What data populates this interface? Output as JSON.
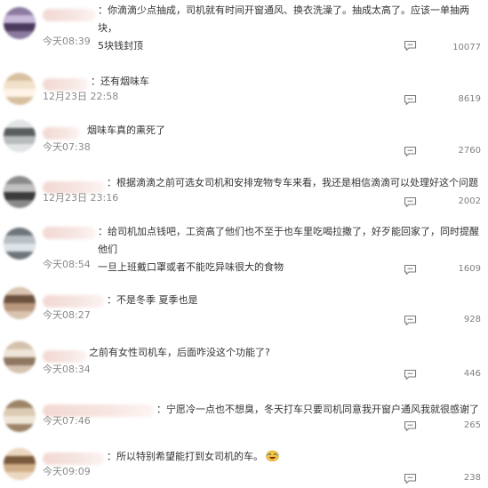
{
  "comments": [
    {
      "text": "：你滴滴少点抽成，司机就有时间开窗通风、换衣洗澡了。抽成太高了。应该一单抽两块，\n5块钱封顶",
      "time": "今天08:39",
      "count": "10077",
      "avatar_color": "#6a5a7e"
    },
    {
      "text": "：还有烟味车",
      "time": "12月23日 22:58",
      "count": "8619",
      "avatar_color": "#e8d8c4"
    },
    {
      "text": "烟味车真的熏死了",
      "time": "今天07:38",
      "count": "2760",
      "avatar_color": "#9aa0a0"
    },
    {
      "text": "：根据滴滴之前可选女司机和安排宠物专车来看，我还是相信滴滴可以处理好这个问题",
      "time": "12月23日 23:16",
      "count": "2002",
      "avatar_color": "#707070"
    },
    {
      "text": "：给司机加点钱吧，工资高了他们也不至于也车里吃喝拉撒了，好歹能回家了，同时提醒他们\n一旦上班戴口罩或者不能吃异味很大的食物",
      "time": "今天08:54",
      "count": "1609",
      "avatar_color": "#9ba3a8"
    },
    {
      "text": "：不是冬季 夏季也是",
      "time": "今天08:27",
      "count": "928",
      "avatar_color": "#a08068"
    },
    {
      "text": "之前有女性司机车，后面咋没这个功能了?",
      "time": "今天08:34",
      "count": "446",
      "avatar_color": "#c0a894"
    },
    {
      "text": "：宁愿冷一点也不想臭，冬天打车只要司机同意我开窗户通风我就很感谢了",
      "time": "今天07:46",
      "count": "265",
      "avatar_color": "#c8b49c"
    },
    {
      "text": "：所以特别希望能打到女司机的车。",
      "time": "今天09:09",
      "count": "238",
      "avatar_color": "#b89470"
    }
  ],
  "icons": {
    "reply": "comment-reply-icon",
    "emoji": "laughing-emoji-icon"
  },
  "colors": {
    "text": "#333333",
    "time": "#8a8a8a",
    "count": "#808080"
  }
}
